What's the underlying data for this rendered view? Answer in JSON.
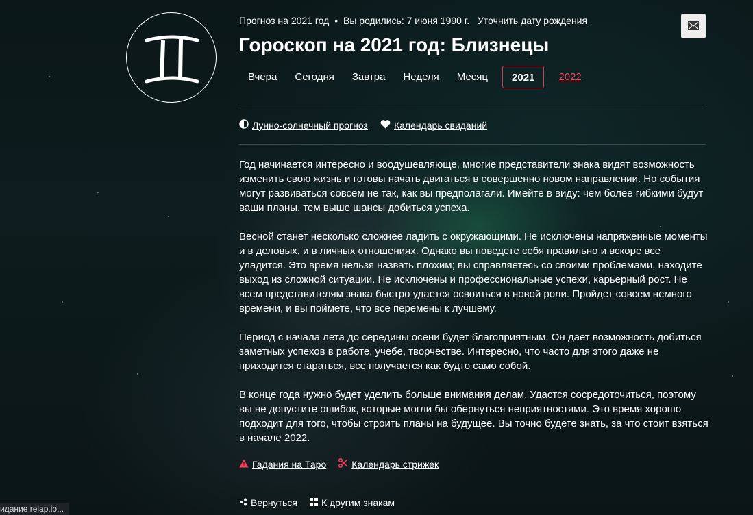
{
  "sign": {
    "name": "Близнецы",
    "icon": "gemini-icon"
  },
  "meta": {
    "forecast": "Прогноз на 2021 год",
    "separator": "•",
    "born": "Вы родились: 7 июня 1990 г.",
    "refine_link": "Уточнить дату рождения"
  },
  "share": {
    "icon": "mail-icon"
  },
  "title": "Гороскоп на 2021 год: Близнецы",
  "tabs": [
    {
      "label": "Вчера"
    },
    {
      "label": "Сегодня"
    },
    {
      "label": "Завтра"
    },
    {
      "label": "Неделя"
    },
    {
      "label": "Месяц"
    },
    {
      "label": "2021",
      "active": true
    },
    {
      "label": "2022"
    }
  ],
  "sublinks": [
    {
      "icon": "half-moon-icon",
      "label": "Лунно-солнечный прогноз"
    },
    {
      "icon": "heart-icon",
      "label": "Календарь свиданий"
    }
  ],
  "paragraphs": [
    "Год начинается интересно и воодушевляюще, многие представители знака видят возможность изменить свою жизнь и готовы начать двигаться в совершенно новом направлении. Но события могут развиваться совсем не так, как вы предполагали. Имейте в виду: чем более гибкими будут ваши планы, тем выше шансы добиться успеха.",
    "Весной станет несколько сложнее ладить с окружающими. Не исключены напряженные моменты и в деловых, и в личных отношениях. Однако вы поведете себя правильно и вскоре все уладится. Это время нельзя назвать плохим; вы справляетесь со своими проблемами, находите выход из сложной ситуации. Не исключены и профессиональные успехи, карьерный рост. Не всем представителям знака быстро удается освоиться в новой роли. Пройдет совсем немного времени, и вы поймете, что все перемены к лучшему.",
    "Период с начала лета до середины осени будет благоприятным. Он дает возможность добиться заметных успехов в работе, учебе, творчестве. Интересно, что часто для этого даже не приходится стараться, все получается как будто само собой.",
    "В конце года нужно будет уделить больше внимания делам. Удастся сосредоточиться, поэтому вы не допустите ошибок, которые могли бы обернуться неприятностями. Это время хорошо подходит для того, чтобы строить планы на будущее. Вы точно будете знать, за что стоит взяться в начале 2022."
  ],
  "bottom_links": [
    {
      "icon": "warning-icon",
      "label": "Гадания на Таро"
    },
    {
      "icon": "scissors-icon",
      "label": "Календарь стрижек"
    }
  ],
  "bottom_links2": [
    {
      "icon": "share-icon",
      "label": "Вернуться"
    },
    {
      "icon": "grid-icon",
      "label": "К другим знакам"
    }
  ],
  "status_bar": "идание relap.io...",
  "colors": {
    "accent": "#e5334a",
    "link_next": "#ff3b56",
    "background": "#0d1c1e"
  }
}
